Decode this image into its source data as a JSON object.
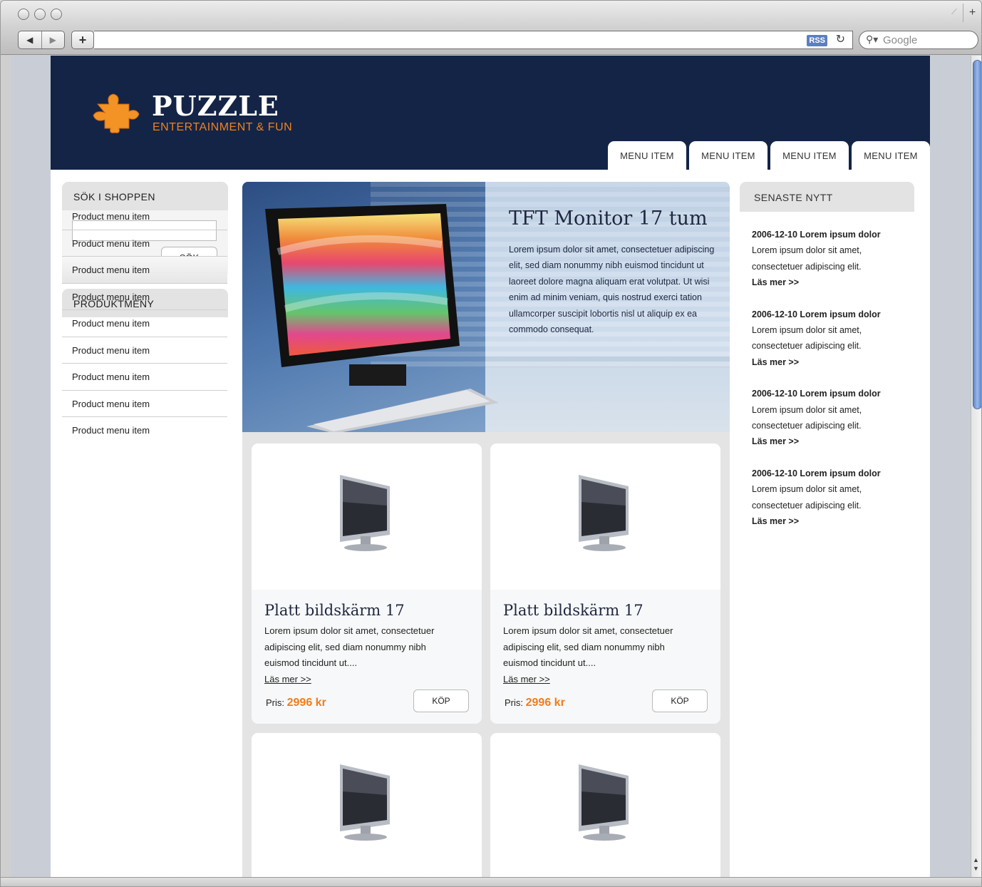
{
  "browser": {
    "search_placeholder": "Google",
    "rss_label": "RSS",
    "add_button_label": "+",
    "new_tab_label": "+"
  },
  "site": {
    "logo": {
      "title": "PUZZLE",
      "subtitle": "ENTERTAINMENT & FUN"
    },
    "menu": [
      "MENU ITEM",
      "MENU ITEM",
      "MENU ITEM",
      "MENU ITEM"
    ],
    "search": {
      "heading": "SÖK I SHOPPEN",
      "input_value": "",
      "button_label": "SÖK"
    },
    "product_menu": {
      "heading": "PRODUKTMENY",
      "items": [
        "Product menu item",
        "Product menu item",
        "Product menu item",
        "Product menu item",
        "Product menu item",
        "Product menu item",
        "Product menu item",
        "Product menu item",
        "Product menu item"
      ],
      "active_index": 2
    },
    "hero": {
      "title": "TFT Monitor 17 tum",
      "text": "Lorem ipsum dolor sit amet, consectetuer adipiscing elit, sed diam nonummy nibh euismod tincidunt ut laoreet dolore magna aliquam erat volutpat. Ut wisi enim ad minim veniam, quis nostrud exerci tation ullamcorper suscipit lobortis nisl ut aliquip ex ea commodo consequat."
    },
    "products": [
      {
        "title": "Platt bildskärm 17",
        "desc": "Lorem ipsum dolor sit amet, consectetuer adipiscing elit, sed diam nonummy nibh euismod tincidunt ut....",
        "link": "Läs mer >>",
        "price_label": "Pris:",
        "price": "2996 kr",
        "buy_label": "KÖP"
      },
      {
        "title": "Platt bildskärm 17",
        "desc": "Lorem ipsum dolor sit amet, consectetuer adipiscing elit, sed diam nonummy nibh euismod tincidunt ut....",
        "link": "Läs mer >>",
        "price_label": "Pris:",
        "price": "2996 kr",
        "buy_label": "KÖP"
      },
      {
        "title": "",
        "desc": "",
        "link": "",
        "price_label": "",
        "price": "",
        "buy_label": ""
      },
      {
        "title": "",
        "desc": "",
        "link": "",
        "price_label": "",
        "price": "",
        "buy_label": ""
      }
    ],
    "news": {
      "heading": "SENASTE NYTT",
      "items": [
        {
          "date_title": "2006-12-10 Lorem ipsum dolor",
          "text": "Lorem ipsum dolor sit amet, consectetuer adipiscing elit.",
          "more": "Läs mer >>"
        },
        {
          "date_title": "2006-12-10 Lorem ipsum dolor",
          "text": "Lorem ipsum dolor sit amet, consectetuer adipiscing elit.",
          "more": "Läs mer >>"
        },
        {
          "date_title": "2006-12-10 Lorem ipsum dolor",
          "text": "Lorem ipsum dolor sit amet, consectetuer adipiscing elit.",
          "more": "Läs mer >>"
        },
        {
          "date_title": "2006-12-10 Lorem ipsum dolor",
          "text": "Lorem ipsum dolor sit amet, consectetuer adipiscing elit.",
          "more": "Läs mer >>"
        }
      ]
    }
  },
  "colors": {
    "header_bg": "#132447",
    "accent_orange": "#f07d1c",
    "panel_gray": "#e3e3e3"
  },
  "icons": [
    "back-arrow-icon",
    "forward-arrow-icon",
    "add-bookmark-icon",
    "rss-icon",
    "reload-icon",
    "search-icon",
    "puzzle-logo-icon",
    "monitor-image"
  ]
}
